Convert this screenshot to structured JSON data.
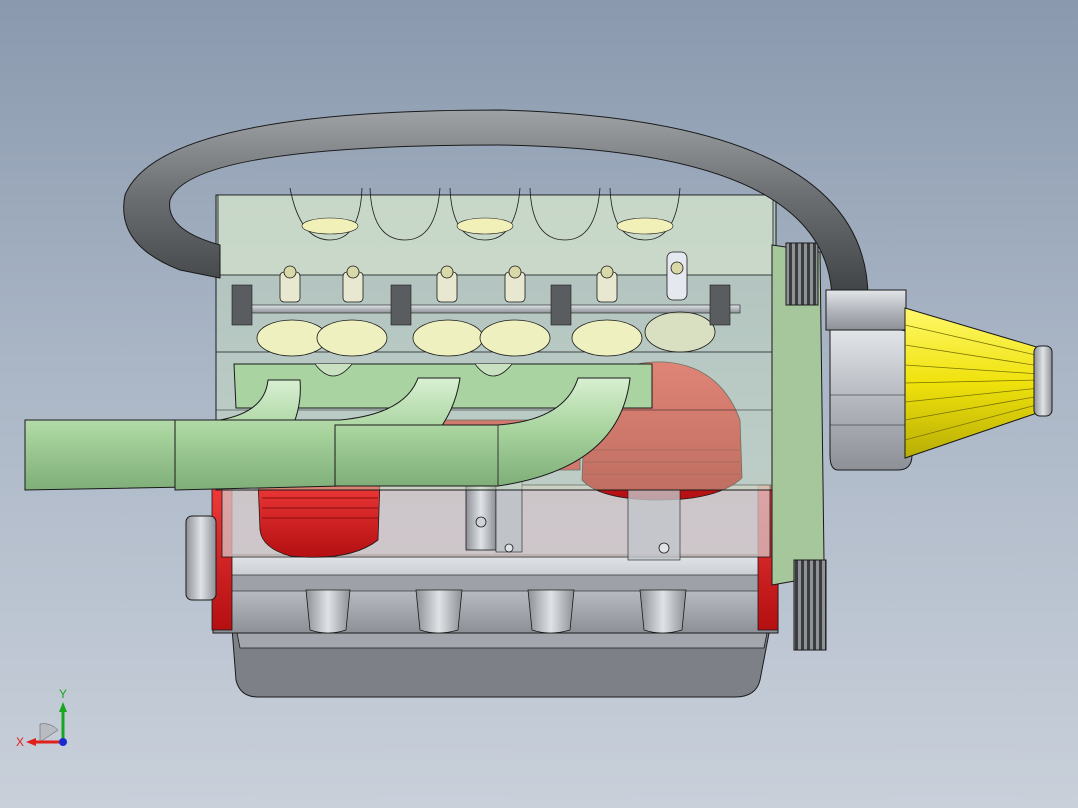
{
  "viewport": {
    "model": "engine-assembly",
    "display_mode": "shaded-with-edges-transparent",
    "background": {
      "top": "#8a99ae",
      "bottom": "#c9d0da"
    }
  },
  "colors": {
    "block_red": "#d9161b",
    "head_green": "#a8cfa0",
    "manifold_green": "#b5dab0",
    "intake_pipe": "#6f7376",
    "filter_yellow": "#f1ea0f",
    "steel_gray": "#b8bcc2",
    "oil_pan": "#9a9ea4",
    "edge": "#1a1a1a"
  },
  "triad": {
    "x_label": "X",
    "y_label": "Y",
    "x_color": "#e0201a",
    "y_color": "#18a520",
    "z_color": "#1b2ad0"
  }
}
